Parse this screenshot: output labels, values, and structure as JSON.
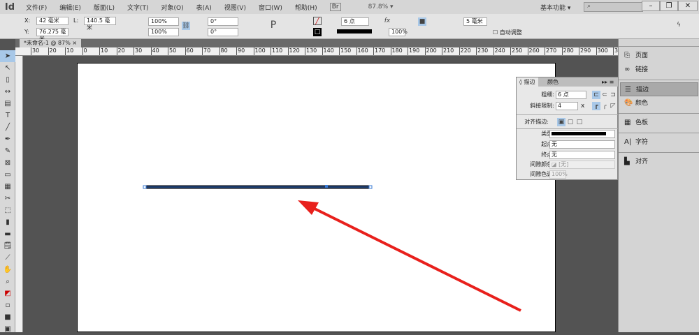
{
  "app": {
    "logo": "Id",
    "menus": [
      "文件(F)",
      "编辑(E)",
      "版面(L)",
      "文字(T)",
      "对象(O)",
      "表(A)",
      "视图(V)",
      "窗口(W)",
      "帮助(H)"
    ],
    "bridge": "Br",
    "zoom": "87.8% ▾",
    "workspace": "基本功能 ▾",
    "search_placeholder": "",
    "win": {
      "min": "–",
      "restore": "❐",
      "close": "✕"
    }
  },
  "control": {
    "x_label": "X:",
    "x": "42 毫米",
    "y_label": "Y:",
    "y": "76.275 毫米",
    "l_label": "L:",
    "l": "140.5 毫米",
    "scale_x": "100%",
    "scale_y": "100%",
    "rotate": "0°",
    "shear": "0°",
    "stroke_weight": "6 点",
    "opacity": "100%",
    "spacing": "5 毫米",
    "auto_fit": "自动调整"
  },
  "document": {
    "tab": "*未命名-1 @ 87%",
    "close": "×"
  },
  "ruler": [
    "30",
    "20",
    "10",
    "0",
    "10",
    "20",
    "30",
    "40",
    "50",
    "60",
    "70",
    "80",
    "90",
    "100",
    "110",
    "120",
    "130",
    "140",
    "150",
    "160",
    "170",
    "180",
    "190",
    "200",
    "210",
    "220",
    "230",
    "240",
    "250",
    "260",
    "270",
    "280",
    "290",
    "300",
    "310",
    "320"
  ],
  "stroke_panel": {
    "tabs": [
      "描边",
      "颜色"
    ],
    "weight_label": "粗细:",
    "weight": "6 点",
    "miter_label": "斜接限制:",
    "miter": "4",
    "miter_unit": "x",
    "align_label": "对齐描边:",
    "type_label": "类型:",
    "start_label": "起点:",
    "start": "无",
    "end_label": "终点:",
    "end": "无",
    "gap_color_label": "间隙颜色:",
    "gap_color": "[无]",
    "gap_tint_label": "间隙色调:",
    "gap_tint": "100%"
  },
  "right_panel": {
    "items": [
      {
        "label": "页面",
        "icon": "pages-icon"
      },
      {
        "label": "链接",
        "icon": "links-icon"
      },
      {
        "label": "描边",
        "icon": "stroke-icon"
      },
      {
        "label": "颜色",
        "icon": "color-icon"
      },
      {
        "label": "色板",
        "icon": "swatches-icon"
      },
      {
        "label": "字符",
        "icon": "character-icon"
      },
      {
        "label": "对齐",
        "icon": "align-icon"
      }
    ]
  },
  "colors": {
    "arrow": "#e8201c",
    "line": "#0a0f1e",
    "selection": "#3a7bd5"
  }
}
